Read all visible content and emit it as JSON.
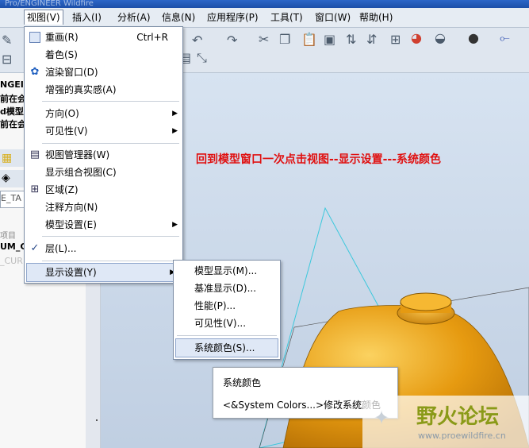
{
  "window": {
    "title": "Pro/ENGINEER Wildfire"
  },
  "menubar": [
    {
      "label": "视图(V)",
      "active": true
    },
    {
      "label": "插入(I)"
    },
    {
      "label": "分析(A)"
    },
    {
      "label": "信息(N)"
    },
    {
      "label": "应用程序(P)"
    },
    {
      "label": "工具(T)"
    },
    {
      "label": "窗口(W)"
    },
    {
      "label": "帮助(H)"
    }
  ],
  "view_menu": {
    "items": [
      {
        "label": "重画(R)",
        "shortcut": "Ctrl+R",
        "icon": "repaint-icon"
      },
      {
        "label": "着色(S)"
      },
      {
        "label": "渲染窗口(D)",
        "icon": "render-window-icon"
      },
      {
        "label": "增强的真实感(A)"
      },
      {
        "label": "方向(O)",
        "submenu": true
      },
      {
        "label": "可见性(V)",
        "submenu": true
      },
      {
        "label": "视图管理器(W)",
        "icon": "view-manager-icon"
      },
      {
        "label": "显示组合视图(C)"
      },
      {
        "label": "区域(Z)",
        "icon": "zone-icon"
      },
      {
        "label": "注释方向(N)"
      },
      {
        "label": "模型设置(E)",
        "submenu": true
      },
      {
        "label": "层(L)...",
        "checked": true
      },
      {
        "label": "显示设置(Y)",
        "submenu": true,
        "highlighted": true
      }
    ]
  },
  "display_settings_menu": {
    "items": [
      {
        "label": "模型显示(M)..."
      },
      {
        "label": "基准显示(D)..."
      },
      {
        "label": "性能(P)..."
      },
      {
        "label": "可见性(V)..."
      },
      {
        "label": "系统颜色(S)...",
        "highlighted": true
      }
    ]
  },
  "tooltip": {
    "title": "系统颜色",
    "text": "<&System Colors...>修改系统颜色"
  },
  "annotation": "回到模型窗口一次点击视图--显示设置---系统颜色",
  "leftpanel": {
    "messages": [
      "NGEI",
      "前在会",
      "d模型",
      "前在会"
    ],
    "tree_label": "E_TA",
    "item_header": "项目",
    "item1": "UM_C",
    "item2": "_CUR"
  },
  "watermark": {
    "title": "野火论坛",
    "url": "www.proewildfire.cn"
  },
  "colors": {
    "annotation": "#e01010",
    "model": "#e89b12",
    "highlight": "#dfe8f6"
  }
}
